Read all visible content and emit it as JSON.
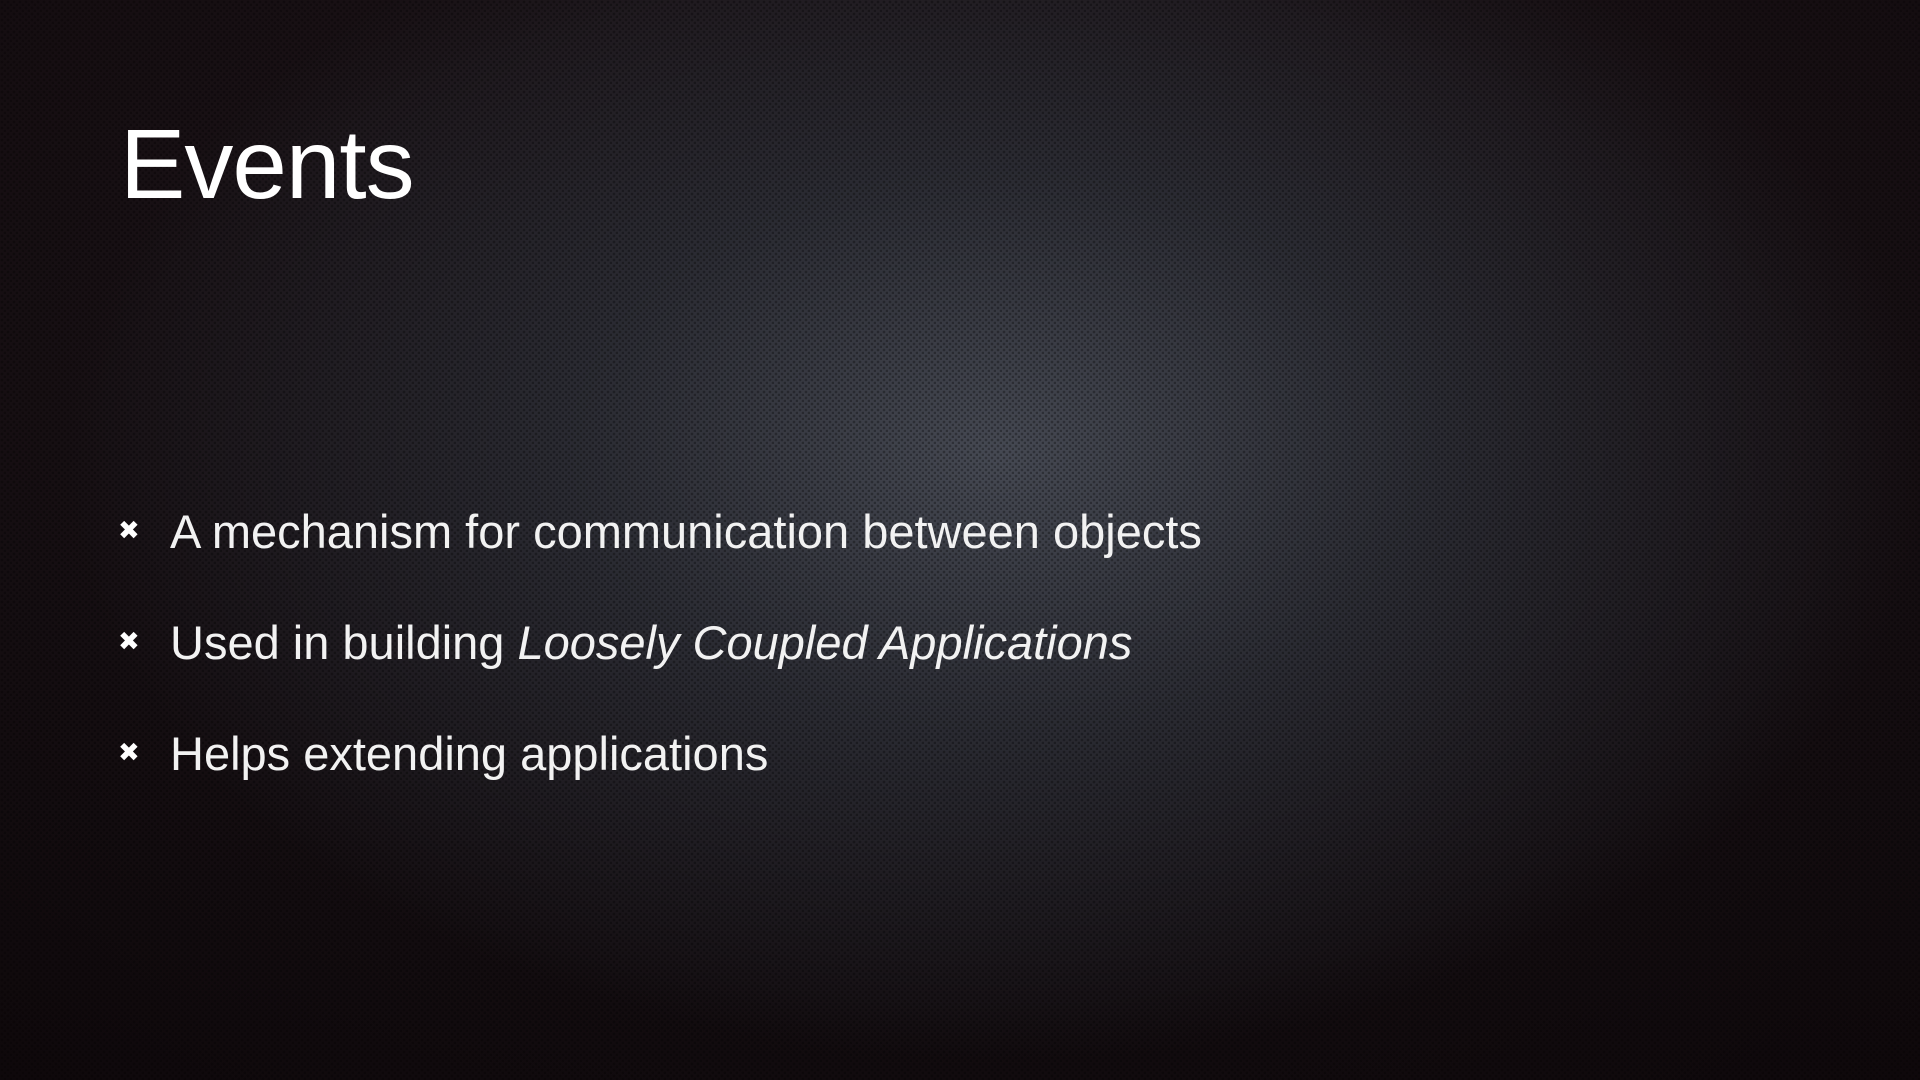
{
  "slide": {
    "title": "Events",
    "bullets": [
      {
        "text": "A mechanism for communication between objects"
      },
      {
        "text_prefix": "Used in building ",
        "text_italic": "Loosely Coupled Applications"
      },
      {
        "text": "Helps extending applications"
      }
    ],
    "bullet_icon": "star-bullet-icon",
    "colors": {
      "text": "#f4f4f4",
      "background": "#120c0f"
    }
  }
}
